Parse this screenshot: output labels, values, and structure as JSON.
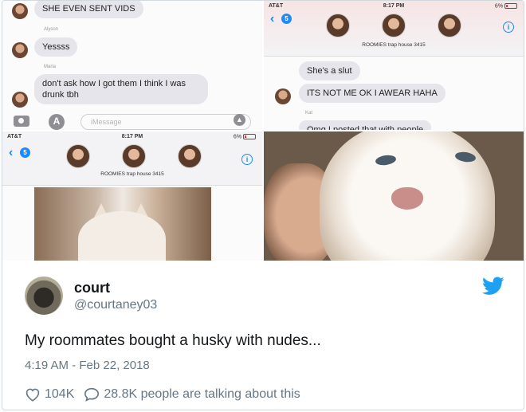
{
  "top_left": {
    "messages": [
      {
        "text": "SHE EVEN SENT VIDS"
      },
      {
        "sender": "Alyson",
        "text": "Yessss"
      },
      {
        "sender": "Maria",
        "text": "don't ask how I got them I think I was drunk tbh"
      }
    ],
    "composer_placeholder": "iMessage"
  },
  "top_right": {
    "status": {
      "carrier": "AT&T",
      "time": "8:17 PM",
      "battery": "6%"
    },
    "back_count": "5",
    "group_name": "ROOMIES trap house 3415",
    "messages": [
      {
        "text": "She's a slut"
      },
      {
        "text": "ITS NOT ME OK I AWEAR HAHA"
      }
    ],
    "sender_partial": "Kat",
    "partial_text": "Omg I posted that with people"
  },
  "bottom_left": {
    "status": {
      "carrier": "AT&T",
      "time": "8:17 PM",
      "battery": "6%"
    },
    "back_count": "5",
    "group_name": "ROOMIES trap house 3415"
  },
  "tweet": {
    "name": "court",
    "handle": "@courtaney03",
    "text": "My roommates bought a husky with nudes...",
    "timestamp": "4:19 AM - Feb 22, 2018",
    "likes": "104K",
    "talking": "28.8K people are talking about this"
  },
  "colors": {
    "twitter_blue": "#1da1f2",
    "ios_blue": "#1a8cff",
    "bubble_gray": "#e6e5eb"
  }
}
